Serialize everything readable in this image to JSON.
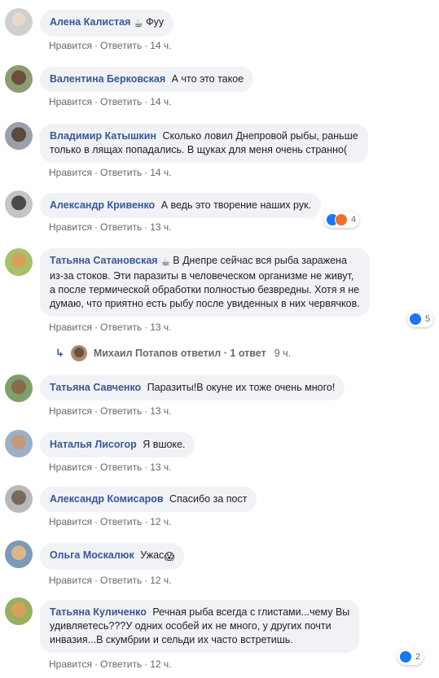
{
  "actions": {
    "like": "Нравится",
    "reply": "Ответить",
    "dot": "·"
  },
  "comments": [
    {
      "author": "Алена Калистая",
      "text": "Фуу",
      "emoji": "☕",
      "time": "14 ч."
    },
    {
      "author": "Валентина Берковская",
      "text": "А что это такое",
      "time": "14 ч."
    },
    {
      "author": "Владимир Катышкин",
      "text_lines": [
        "Сколько ловил Днепровой рыбы, раньше",
        "только в лящах попадались. В щуках для меня очень странно("
      ],
      "time": "14 ч."
    },
    {
      "author": "Александр Кривенко",
      "text": "А ведь это творение наших рук.",
      "time": "13 ч.",
      "reactions": "4"
    },
    {
      "author": "Татьяна Сатановская",
      "emoji": "☕",
      "text_lines": [
        "В Днепре сейчас вся рыба заражена",
        "из-за стоков. Эти паразиты в человеческом организме не живут,",
        "а после термической обработки полностью безвредны. Хотя я не",
        "думаю, что приятно есть рыбу после увиденных в них червячков."
      ],
      "time": "13 ч.",
      "reactions": "5"
    },
    {
      "author": "Татьяна Савченко",
      "text": "Паразиты!В окуне их тоже очень много!",
      "time": "13 ч."
    },
    {
      "author": "Наталья Лисогор",
      "text": "Я вшоке.",
      "time": "13 ч."
    },
    {
      "author": "Александр Комисаров",
      "text": "Спасибо за пост",
      "time": "12 ч."
    },
    {
      "author": "Ольга Москалюк",
      "text": "Ужас",
      "emoji": "😱",
      "time": "12 ч."
    },
    {
      "author": "Татьяна Куличенко",
      "text_lines": [
        "Речная рыба всегда с глистами...чему Вы",
        "удивляетесь???У одних особей их не много, у других почти",
        "инвазия...В скумбрии и сельди их часто встретишь."
      ],
      "time": "12 ч.",
      "reactions": "2"
    }
  ],
  "reply": {
    "author": "Михаил Потапов",
    "verb": "ответил",
    "dot": "·",
    "count": "1 ответ",
    "time": "9 ч."
  },
  "colors": {
    "name": "#385898",
    "bubble": "#f0f2f5",
    "meta": "#65676b",
    "like": "#1877f2",
    "haha": "#f7b125",
    "love": "#f33e58"
  }
}
